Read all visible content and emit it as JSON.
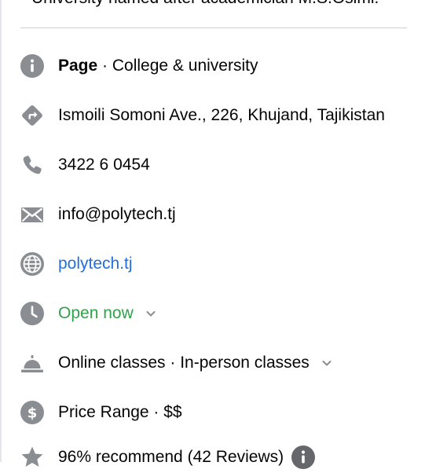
{
  "intro": {
    "text": "University named after academician M.S.Osimi."
  },
  "category": {
    "type_label": "Page",
    "separator": " · ",
    "category": "College & university"
  },
  "address": {
    "text": "Ismoili Somoni Ave., 226, Khujand, Tajikistan"
  },
  "phone": {
    "text": "3422 6 0454"
  },
  "email": {
    "text": "info@polytech.tj"
  },
  "website": {
    "text": "polytech.tj"
  },
  "hours": {
    "text": "Open now"
  },
  "services": {
    "text": "Online classes · In-person classes"
  },
  "price": {
    "text": "Price Range · $$"
  },
  "rating": {
    "text": "96% recommend (42 Reviews)"
  },
  "colors": {
    "icon": "#8a8d91",
    "link": "#216fdb",
    "open": "#31a24c",
    "text": "#050505",
    "divider": "#ced0d4"
  },
  "icons": [
    "info-icon",
    "directions-icon",
    "phone-icon",
    "mail-icon",
    "globe-icon",
    "clock-icon",
    "service-bell-icon",
    "price-icon",
    "star-icon",
    "chevron-down-icon"
  ]
}
